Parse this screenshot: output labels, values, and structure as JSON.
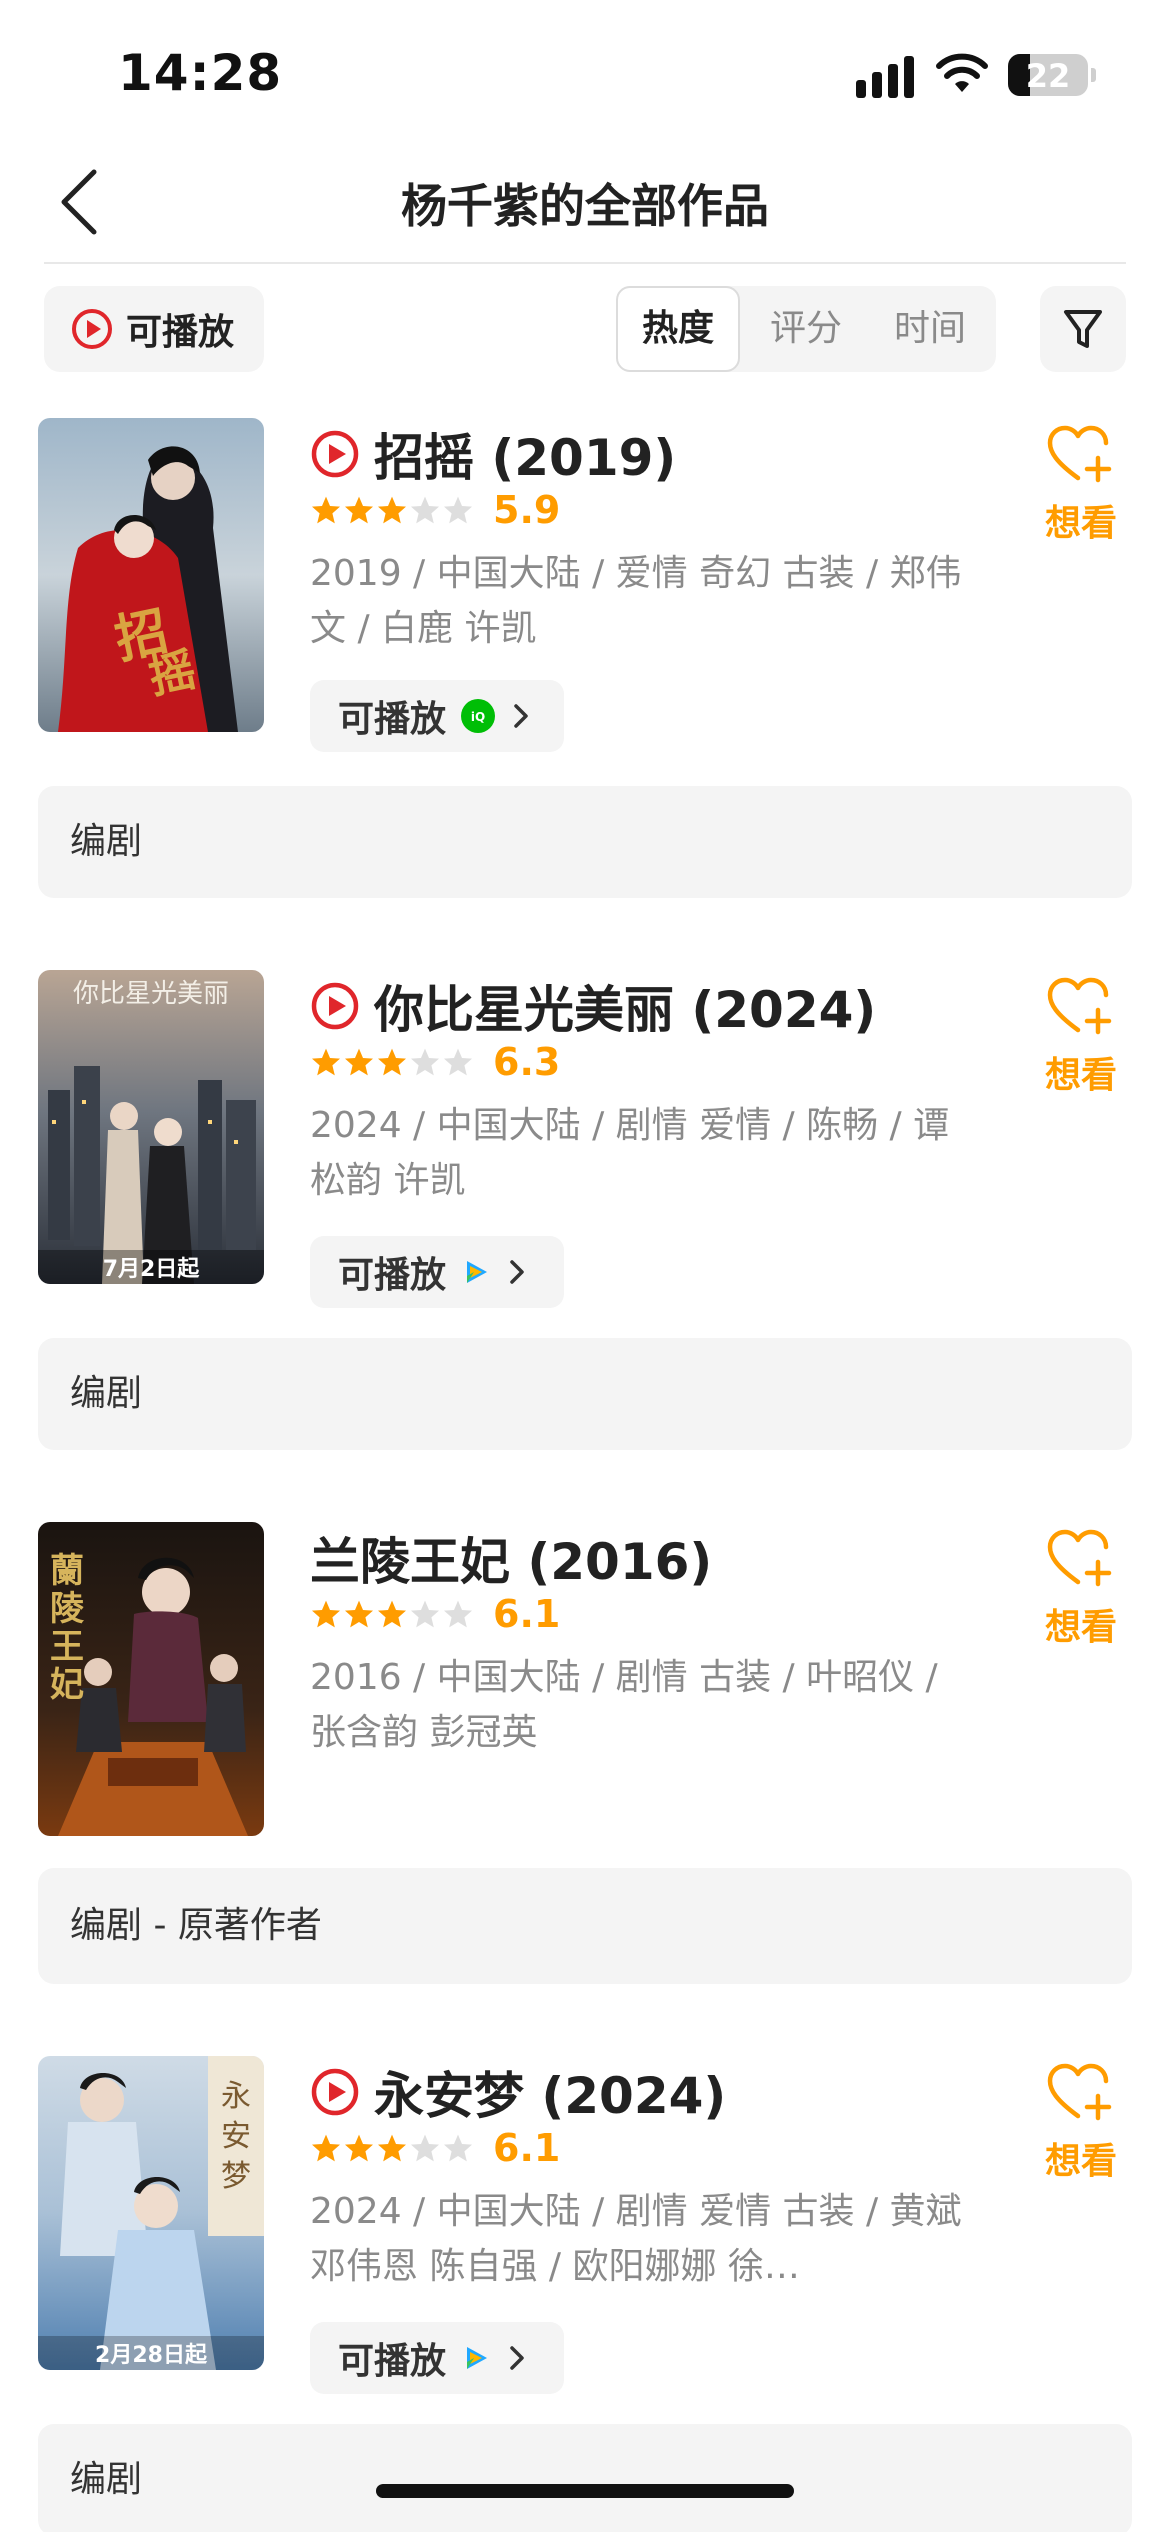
{
  "status_bar": {
    "time": "14:28",
    "battery": "22"
  },
  "nav": {
    "title": "杨千紫的全部作品"
  },
  "filters": {
    "playable_label": "可播放",
    "sort_tabs": [
      "热度",
      "评分",
      "时间"
    ],
    "active_sort": "热度"
  },
  "accent_color": "#ff9c00",
  "play_color": "#e0262b",
  "works": [
    {
      "title": "招摇 (2019)",
      "playable": true,
      "stars": 3,
      "score": "5.9",
      "meta": "2019 / 中国大陆 / 爱情 奇幻 古装 / 郑伟文 / 白鹿 许凯",
      "playable_button": "可播放",
      "platform_icon": "iqiyi-icon",
      "want": "想看",
      "role": "编剧"
    },
    {
      "title": "你比星光美丽 (2024)",
      "playable": true,
      "stars": 3,
      "score": "6.3",
      "meta": "2024 / 中国大陆 / 剧情 爱情 / 陈畅 / 谭松韵 许凯",
      "poster_caption": "7月2日起",
      "playable_button": "可播放",
      "platform_icon": "tencent-video-icon",
      "want": "想看",
      "role": "编剧"
    },
    {
      "title": "兰陵王妃 (2016)",
      "playable": false,
      "stars": 3,
      "score": "6.1",
      "meta": "2016 / 中国大陆 / 剧情 古装 / 叶昭仪 / 张含韵 彭冠英",
      "want": "想看",
      "role": "编剧 - 原著作者"
    },
    {
      "title": "永安梦 (2024)",
      "playable": true,
      "stars": 3,
      "score": "6.1",
      "meta": "2024 / 中国大陆 / 剧情 爱情 古装 / 黄斌 邓伟恩 陈自强 / 欧阳娜娜 徐…",
      "poster_caption": "2月28日起",
      "playable_button": "可播放",
      "platform_icon": "tencent-video-icon",
      "want": "想看",
      "role": "编剧"
    }
  ]
}
